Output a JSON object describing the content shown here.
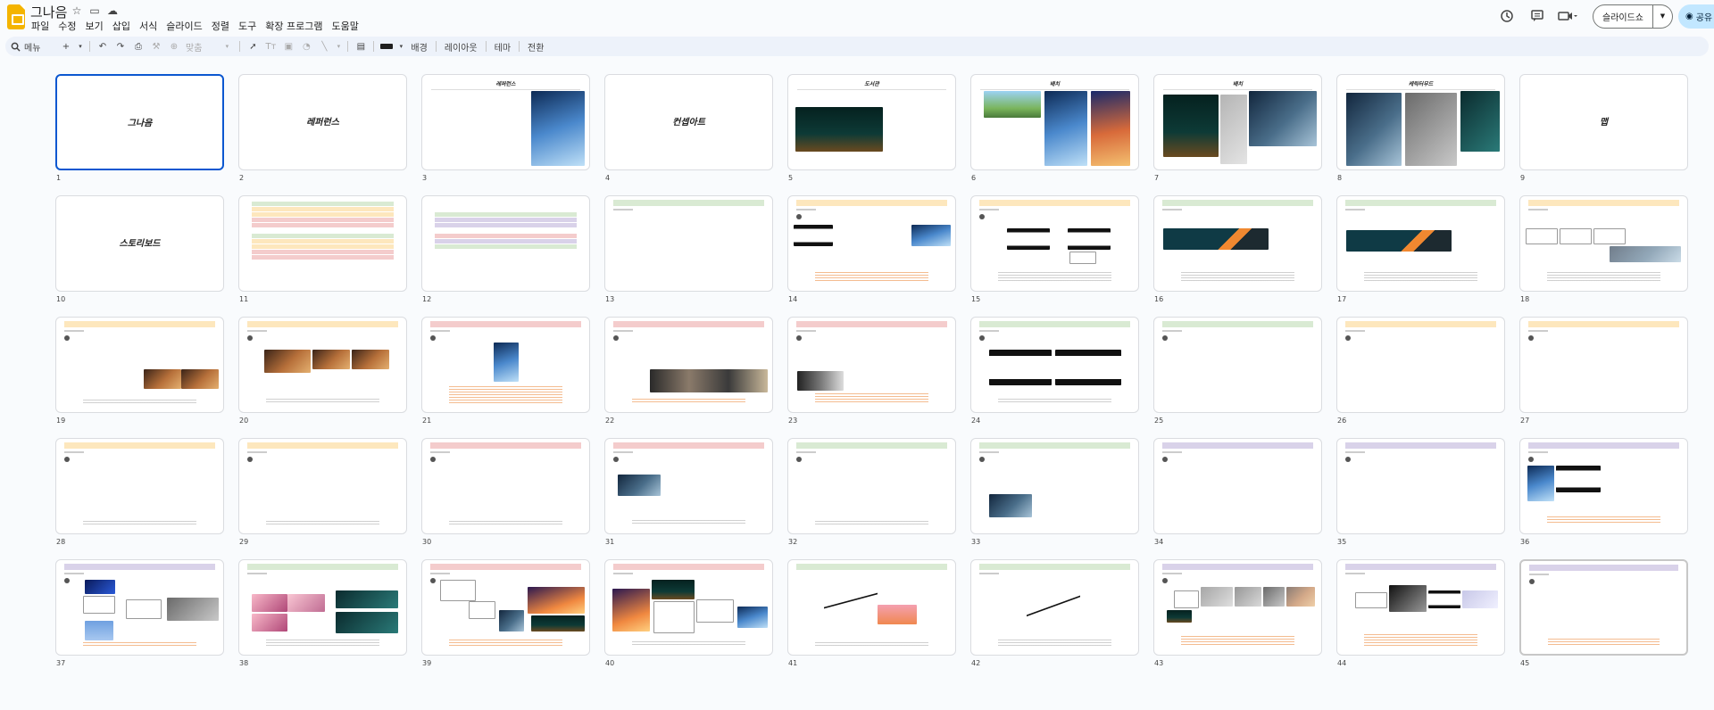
{
  "app": {
    "doc_title": "그나음",
    "menu": [
      "파일",
      "수정",
      "보기",
      "삽입",
      "서식",
      "슬라이드",
      "정렬",
      "도구",
      "확장 프로그램",
      "도움말"
    ],
    "slideshow_label": "슬라이드쇼",
    "share_label": "공유"
  },
  "toolbar": {
    "search_label": "메뉴",
    "zoom_label": "맞춤",
    "background_label": "배경",
    "layout_label": "레이아웃",
    "theme_label": "테마",
    "transition_label": "전환"
  },
  "slides": [
    {
      "num": "1",
      "kind": "title",
      "title": "그나음"
    },
    {
      "num": "2",
      "kind": "title",
      "title": "레퍼런스"
    },
    {
      "num": "3",
      "kind": "head",
      "title": "레퍼런스"
    },
    {
      "num": "4",
      "kind": "title",
      "title": "컨셉아트"
    },
    {
      "num": "5",
      "kind": "head",
      "title": "도서관"
    },
    {
      "num": "6",
      "kind": "head",
      "title": "배치"
    },
    {
      "num": "7",
      "kind": "head",
      "title": "배치"
    },
    {
      "num": "8",
      "kind": "head",
      "title": "캐릭터무드"
    },
    {
      "num": "9",
      "kind": "title",
      "title": "맵"
    },
    {
      "num": "10",
      "kind": "title",
      "title": "스토리보드"
    },
    {
      "num": "11",
      "kind": "table"
    },
    {
      "num": "12",
      "kind": "table"
    },
    {
      "num": "13",
      "kind": "board"
    },
    {
      "num": "14",
      "kind": "board"
    },
    {
      "num": "15",
      "kind": "board"
    },
    {
      "num": "16",
      "kind": "board"
    },
    {
      "num": "17",
      "kind": "board"
    },
    {
      "num": "18",
      "kind": "board"
    },
    {
      "num": "19",
      "kind": "board"
    },
    {
      "num": "20",
      "kind": "board"
    },
    {
      "num": "21",
      "kind": "board"
    },
    {
      "num": "22",
      "kind": "board"
    },
    {
      "num": "23",
      "kind": "board"
    },
    {
      "num": "24",
      "kind": "board"
    },
    {
      "num": "25",
      "kind": "board"
    },
    {
      "num": "26",
      "kind": "board"
    },
    {
      "num": "27",
      "kind": "board"
    },
    {
      "num": "28",
      "kind": "board"
    },
    {
      "num": "29",
      "kind": "board"
    },
    {
      "num": "30",
      "kind": "board"
    },
    {
      "num": "31",
      "kind": "board"
    },
    {
      "num": "32",
      "kind": "board"
    },
    {
      "num": "33",
      "kind": "board"
    },
    {
      "num": "34",
      "kind": "board"
    },
    {
      "num": "35",
      "kind": "board"
    },
    {
      "num": "36",
      "kind": "board"
    },
    {
      "num": "37",
      "kind": "board"
    },
    {
      "num": "38",
      "kind": "board"
    },
    {
      "num": "39",
      "kind": "board"
    },
    {
      "num": "40",
      "kind": "board"
    },
    {
      "num": "41",
      "kind": "board"
    },
    {
      "num": "42",
      "kind": "board"
    },
    {
      "num": "43",
      "kind": "board"
    },
    {
      "num": "44",
      "kind": "board"
    },
    {
      "num": "45",
      "kind": "board"
    }
  ]
}
